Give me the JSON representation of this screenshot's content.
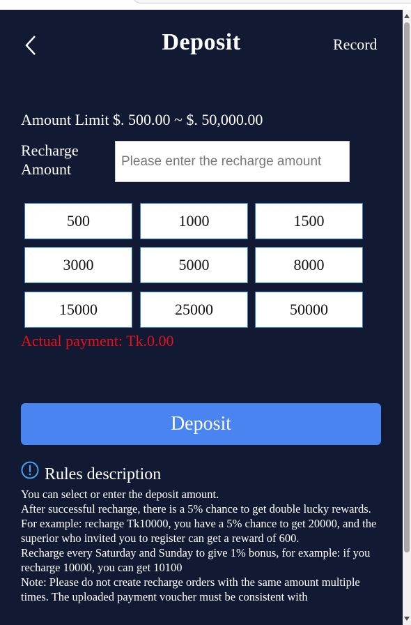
{
  "header": {
    "title": "Deposit",
    "record_label": "Record"
  },
  "amount_limit": "Amount Limit $. 500.00 ~ $. 50,000.00",
  "recharge": {
    "label": "Recharge Amount",
    "placeholder": "Please enter the recharge amount",
    "value": ""
  },
  "quick_amounts": [
    "500",
    "1000",
    "1500",
    "3000",
    "5000",
    "8000",
    "15000",
    "25000",
    "50000"
  ],
  "actual_payment": "Actual payment: Tk.0.00",
  "deposit_button": "Deposit",
  "rules": {
    "title": "Rules description",
    "text": "You can select or enter the deposit amount.\nAfter successful recharge, there is a 5% chance to get double lucky rewards.\nFor example: recharge Tk10000, you have a 5% chance to get 20000, and the superior who invited you to register can get a reward of 600.\nRecharge every Saturday and Sunday to give 1% bonus, for example: if you recharge 10000, you can get 10100\nNote: Please do not create recharge orders with the same amount multiple times. The uploaded payment voucher must be consistent with"
  },
  "colors": {
    "background": "#121a33",
    "accent": "#4a84f0",
    "warning": "#e8101b",
    "chip_border": "#2f80c8"
  },
  "icons": {
    "back": "chevron-left-icon",
    "rules": "info-exclamation-icon"
  }
}
